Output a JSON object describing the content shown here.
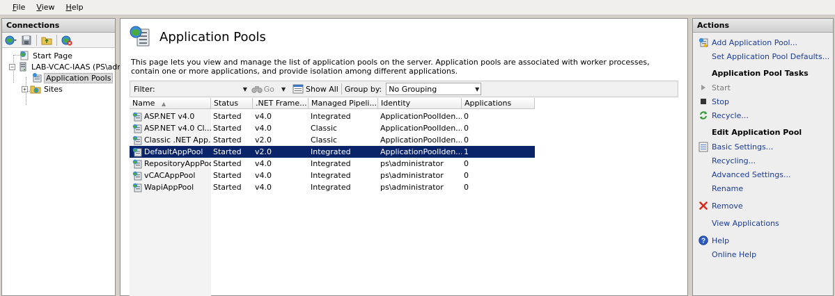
{
  "menu": [
    {
      "label": "File",
      "u": "F",
      "rest": "ile"
    },
    {
      "label": "View",
      "u": "V",
      "rest": "iew"
    },
    {
      "label": "Help",
      "u": "H",
      "rest": "elp"
    }
  ],
  "connections": {
    "title": "Connections",
    "tree": {
      "start_page": "Start Page",
      "server": "LAB-VCAC-IAAS (PS\\adm",
      "app_pools": "Application Pools",
      "sites": "Sites"
    }
  },
  "main": {
    "title": "Application Pools",
    "description": "This page lets you view and manage the list of application pools on the server. Application pools are associated with worker processes, contain one or more applications, and provide isolation among different applications.",
    "filter": {
      "label": "Filter:",
      "value": "",
      "go_label": "Go",
      "show_all_label": "Show All",
      "group_by_label": "Group by:",
      "group_by_value": "No Grouping"
    },
    "columns": [
      "Name",
      "Status",
      ".NET Frame...",
      "Managed Pipeli...",
      "Identity",
      "Applications"
    ],
    "sorted_column": "Name",
    "rows": [
      {
        "name": "ASP.NET v4.0",
        "status": "Started",
        "net": "v4.0",
        "pipeline": "Integrated",
        "identity": "ApplicationPoolIden...",
        "apps": "0"
      },
      {
        "name": "ASP.NET v4.0 Cl...",
        "status": "Started",
        "net": "v4.0",
        "pipeline": "Classic",
        "identity": "ApplicationPoolIden...",
        "apps": "0"
      },
      {
        "name": "Classic .NET App...",
        "status": "Started",
        "net": "v2.0",
        "pipeline": "Classic",
        "identity": "ApplicationPoolIden...",
        "apps": "0"
      },
      {
        "name": "DefaultAppPool",
        "status": "Started",
        "net": "v2.0",
        "pipeline": "Integrated",
        "identity": "ApplicationPoolIden...",
        "apps": "1",
        "selected": true
      },
      {
        "name": "RepositoryAppPool",
        "status": "Started",
        "net": "v4.0",
        "pipeline": "Integrated",
        "identity": "ps\\administrator",
        "apps": "0"
      },
      {
        "name": "vCACAppPool",
        "status": "Started",
        "net": "v4.0",
        "pipeline": "Integrated",
        "identity": "ps\\administrator",
        "apps": "0"
      },
      {
        "name": "WapiAppPool",
        "status": "Started",
        "net": "v4.0",
        "pipeline": "Integrated",
        "identity": "ps\\administrator",
        "apps": "0"
      }
    ]
  },
  "actions": {
    "title": "Actions",
    "add_pool": "Add Application Pool...",
    "set_defaults": "Set Application Pool Defaults...",
    "tasks_header": "Application Pool Tasks",
    "start": "Start",
    "stop": "Stop",
    "recycle": "Recycle...",
    "edit_header": "Edit Application Pool",
    "basic_settings": "Basic Settings...",
    "recycling": "Recycling...",
    "advanced_settings": "Advanced Settings...",
    "rename": "Rename",
    "remove": "Remove",
    "view_apps": "View Applications",
    "help": "Help",
    "online_help": "Online Help"
  },
  "colors": {
    "selection": "#0a246a",
    "link": "#1a3a97",
    "remove_icon": "#d62b1f",
    "help_icon": "#2a5bc4"
  }
}
